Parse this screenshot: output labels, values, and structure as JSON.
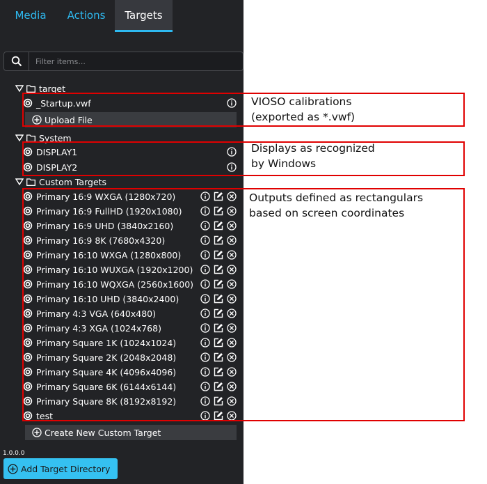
{
  "tabs": [
    {
      "label": "Media"
    },
    {
      "label": "Actions"
    },
    {
      "label": "Targets"
    }
  ],
  "search": {
    "placeholder": "Filter items..."
  },
  "folders": {
    "target": "target",
    "system": "System",
    "custom": "Custom Targets"
  },
  "target_items": [
    {
      "label": "_Startup.vwf"
    }
  ],
  "upload_label": "Upload File",
  "system_items": [
    {
      "label": "DISPLAY1"
    },
    {
      "label": "DISPLAY2"
    }
  ],
  "custom_items": [
    {
      "label": "Primary 16:9 WXGA (1280x720)"
    },
    {
      "label": "Primary 16:9 FullHD (1920x1080)"
    },
    {
      "label": "Primary 16:9 UHD (3840x2160)"
    },
    {
      "label": "Primary 16:9 8K (7680x4320)"
    },
    {
      "label": "Primary 16:10 WXGA (1280x800)"
    },
    {
      "label": "Primary 16:10 WUXGA (1920x1200)"
    },
    {
      "label": "Primary 16:10 WQXGA (2560x1600)"
    },
    {
      "label": "Primary 16:10 UHD (3840x2400)"
    },
    {
      "label": "Primary 4:3 VGA (640x480)"
    },
    {
      "label": "Primary 4:3 XGA (1024x768)"
    },
    {
      "label": "Primary Square 1K (1024x1024)"
    },
    {
      "label": "Primary Square 2K (2048x2048)"
    },
    {
      "label": "Primary Square 4K (4096x4096)"
    },
    {
      "label": "Primary Square 6K (6144x6144)"
    },
    {
      "label": "Primary Square 8K (8192x8192)"
    },
    {
      "label": "test"
    }
  ],
  "create_custom_label": "Create New Custom Target",
  "version": "1.0.0.0",
  "add_directory_label": "Add Target Directory",
  "annotations": {
    "vioso_line1": "VIOSO calibrations",
    "vioso_line2": "(exported as *.vwf)",
    "displays_line1": "Displays as recognized",
    "displays_line2": "by Windows",
    "outputs_line1": "Outputs defined as rectangulars",
    "outputs_line2": "based on screen coordinates"
  },
  "colors": {
    "panel_bg": "#222326",
    "accent": "#2eb9f0",
    "button_bg": "#35c1f1",
    "annotation_red": "#e00000"
  },
  "icons": {
    "search": "search-icon",
    "folder": "folder-icon",
    "caret": "caret-down-icon",
    "target": "target-icon",
    "info": "info-icon",
    "edit": "edit-icon",
    "delete": "close-circle-icon",
    "add": "plus-circle-icon"
  }
}
